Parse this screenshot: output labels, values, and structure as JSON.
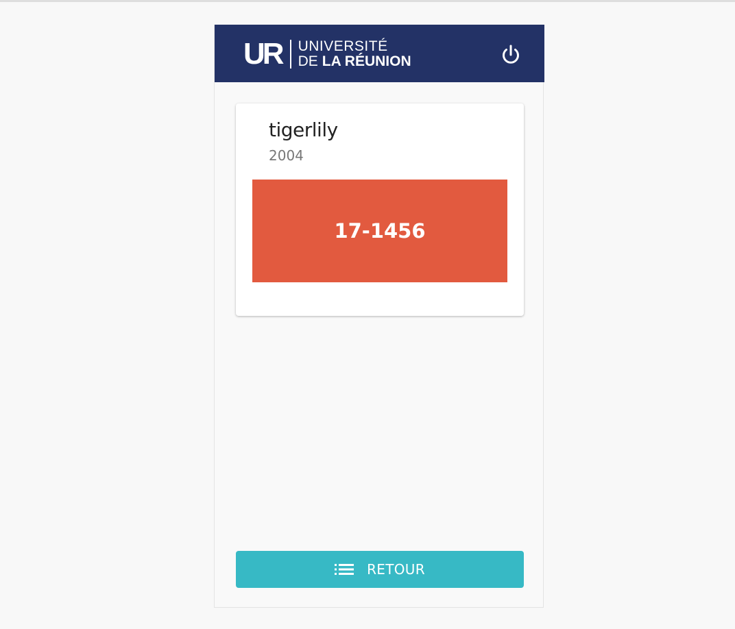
{
  "header": {
    "logo_mark": "UR",
    "logo_line1": "UNIVERSITÉ",
    "logo_line2_prefix": "DE",
    "logo_line2_strong": "LA RÉUNION",
    "power_icon": "power-icon",
    "color": "#233266"
  },
  "card": {
    "title": "tigerlily",
    "subtitle": "2004",
    "code": "17-1456",
    "code_color": "#e25a3f"
  },
  "footer": {
    "retour_label": "RETOUR",
    "retour_icon": "list-icon",
    "button_color": "#37b9c5"
  }
}
